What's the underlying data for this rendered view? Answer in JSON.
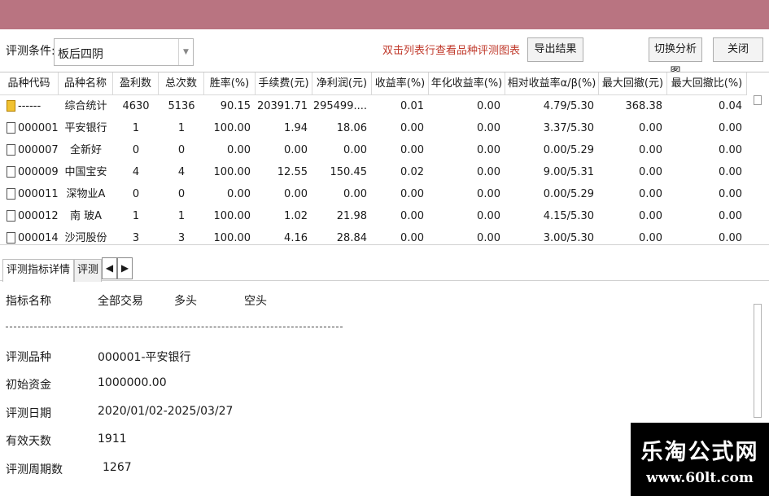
{
  "toolbar": {
    "condition_label": "评测条件:",
    "condition_value": "板后四阴",
    "hint": "双击列表行查看品种评测图表",
    "export_label": "导出结果",
    "switch_label": "切换分析图",
    "close_label": "关闭"
  },
  "table": {
    "headers": [
      "品种代码",
      "品种名称",
      "盈利数",
      "总次数",
      "胜率(%)",
      "手续费(元)",
      "净利润(元)",
      "收益率(%)",
      "年化收益率(%)",
      "相对收益率α/β(%)",
      "最大回撤(元)",
      "最大回撤比(%)"
    ],
    "rows": [
      {
        "code": "------",
        "name": "综合统计",
        "wins": "4630",
        "total": "5136",
        "winrate": "90.15",
        "fee": "20391.71",
        "profit": "295499....",
        "ret": "0.01",
        "annual": "0.00",
        "relative": "4.79/5.30",
        "maxdd": "368.38",
        "maxddr": "0.04"
      },
      {
        "code": "000001",
        "name": "平安银行",
        "wins": "1",
        "total": "1",
        "winrate": "100.00",
        "fee": "1.94",
        "profit": "18.06",
        "ret": "0.00",
        "annual": "0.00",
        "relative": "3.37/5.30",
        "maxdd": "0.00",
        "maxddr": "0.00"
      },
      {
        "code": "000007",
        "name": "全新好",
        "wins": "0",
        "total": "0",
        "winrate": "0.00",
        "fee": "0.00",
        "profit": "0.00",
        "ret": "0.00",
        "annual": "0.00",
        "relative": "0.00/5.29",
        "maxdd": "0.00",
        "maxddr": "0.00"
      },
      {
        "code": "000009",
        "name": "中国宝安",
        "wins": "4",
        "total": "4",
        "winrate": "100.00",
        "fee": "12.55",
        "profit": "150.45",
        "ret": "0.02",
        "annual": "0.00",
        "relative": "9.00/5.31",
        "maxdd": "0.00",
        "maxddr": "0.00"
      },
      {
        "code": "000011",
        "name": "深物业A",
        "wins": "0",
        "total": "0",
        "winrate": "0.00",
        "fee": "0.00",
        "profit": "0.00",
        "ret": "0.00",
        "annual": "0.00",
        "relative": "0.00/5.29",
        "maxdd": "0.00",
        "maxddr": "0.00"
      },
      {
        "code": "000012",
        "name": "南 玻A",
        "wins": "1",
        "total": "1",
        "winrate": "100.00",
        "fee": "1.02",
        "profit": "21.98",
        "ret": "0.00",
        "annual": "0.00",
        "relative": "4.15/5.30",
        "maxdd": "0.00",
        "maxddr": "0.00"
      },
      {
        "code": "000014",
        "name": "沙河股份",
        "wins": "3",
        "total": "3",
        "winrate": "100.00",
        "fee": "4.16",
        "profit": "28.84",
        "ret": "0.00",
        "annual": "0.00",
        "relative": "3.00/5.30",
        "maxdd": "0.00",
        "maxddr": "0.00"
      }
    ]
  },
  "tabs": {
    "items": [
      "评测指标详情",
      "评测"
    ],
    "prev": "◀",
    "next": "▶"
  },
  "detail": {
    "header_name": "指标名称",
    "header_all": "全部交易",
    "header_long": "多头",
    "header_short": "空头",
    "rows": [
      {
        "label": "评测品种",
        "value": "000001-平安银行"
      },
      {
        "label": "初始资金",
        "value": "1000000.00"
      },
      {
        "label": "评测日期",
        "value": "2020/01/02-2025/03/27"
      },
      {
        "label": "有效天数",
        "value": "1911"
      },
      {
        "label": "评测周期数",
        "value": "1267"
      }
    ]
  },
  "watermark": {
    "title": "乐淘公式网",
    "url": "www.60lt.com"
  }
}
